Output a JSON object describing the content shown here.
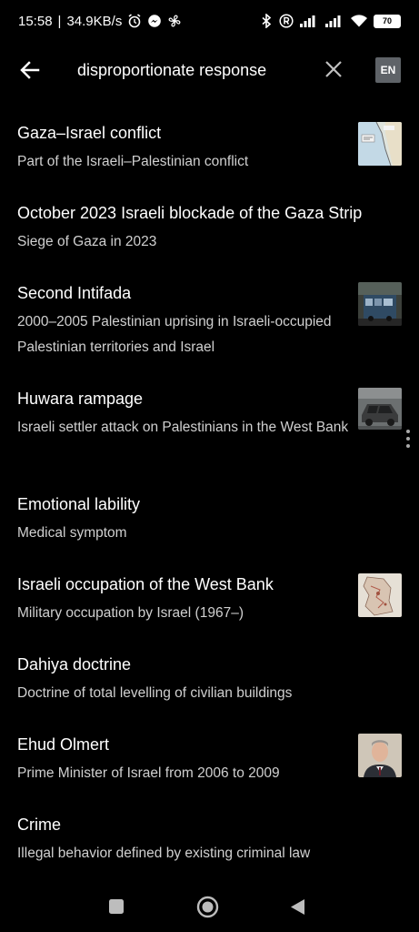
{
  "status_bar": {
    "time": "15:58",
    "separator": "|",
    "speed": "34.9KB/s",
    "battery": "70"
  },
  "search": {
    "query": "disproportionate response",
    "lang": "EN"
  },
  "results": [
    {
      "title": "Gaza–Israel conflict",
      "desc": "Part of the Israeli–Palestinian conflict",
      "thumb": "map-thumbnail"
    },
    {
      "title": "October 2023 Israeli blockade of the Gaza Strip",
      "desc": "Siege of Gaza in 2023"
    },
    {
      "title": "Second Intifada",
      "desc": "2000–2005 Palestinian uprising in Israeli-occupied Palestinian territories and Israel",
      "thumb": "bus-photo-thumbnail"
    },
    {
      "title": "Huwara rampage",
      "desc": "Israeli settler attack on Palestinians in the West Bank",
      "thumb": "burned-car-thumbnail"
    },
    {
      "title": "Emotional lability",
      "desc": "Medical symptom"
    },
    {
      "title": "Israeli occupation of the West Bank",
      "desc": "Military occupation by Israel (1967–)",
      "thumb": "map-thumbnail"
    },
    {
      "title": "Dahiya doctrine",
      "desc": "Doctrine of total levelling of civilian buildings"
    },
    {
      "title": "Ehud Olmert",
      "desc": "Prime Minister of Israel from 2006 to 2009",
      "thumb": "portrait-thumbnail"
    },
    {
      "title": "Crime",
      "desc": "Illegal behavior defined by existing criminal law"
    }
  ],
  "colors": {
    "background": "#000000",
    "text": "#ffffff",
    "secondary_text": "#d0d0d0",
    "lang_badge": "#5f6368"
  }
}
